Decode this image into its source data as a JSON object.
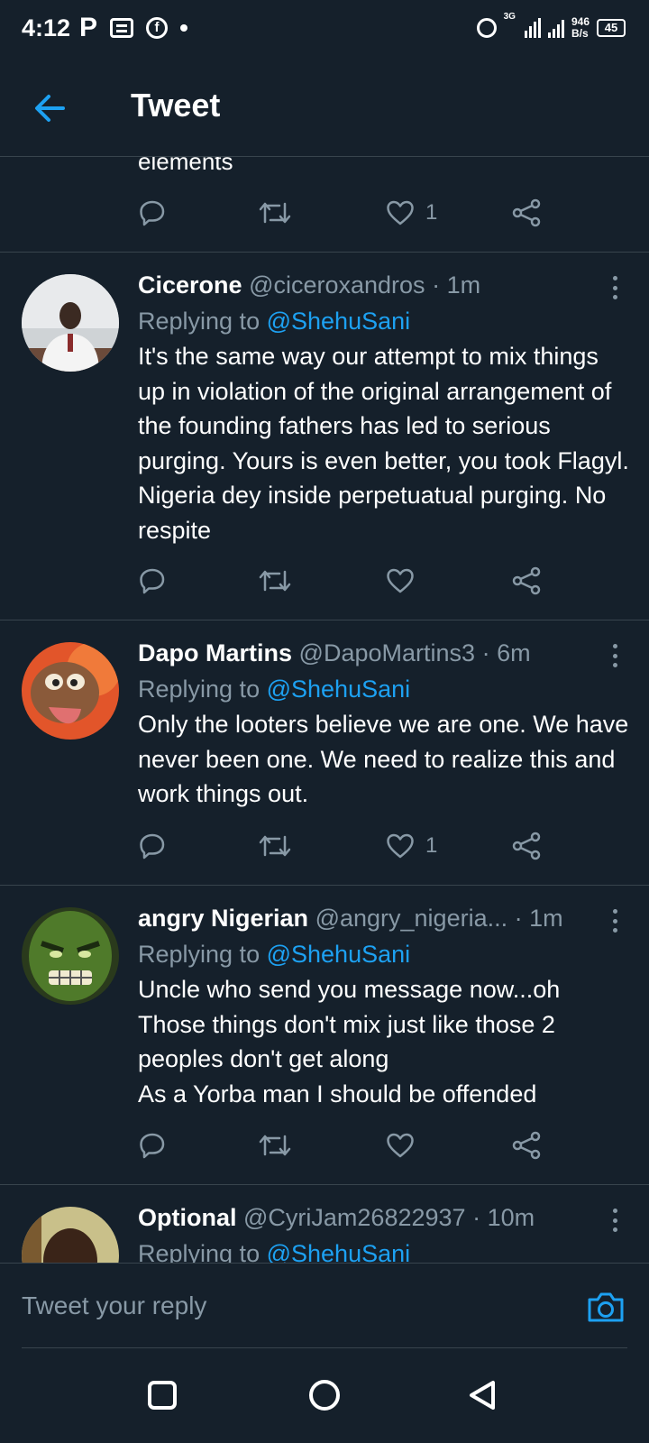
{
  "status_bar": {
    "time": "4:12",
    "left_icons": [
      "parking-icon",
      "message-icon",
      "facebook-icon",
      "dot-icon"
    ],
    "network_type": "3G",
    "speed_value": "946",
    "speed_unit": "B/s",
    "battery": "45"
  },
  "header": {
    "title": "Tweet"
  },
  "partial_tweet": {
    "text": "elements",
    "like_count": "1"
  },
  "replies": [
    {
      "name": "Cicerone",
      "handle": "@ciceroxandros",
      "separator": "·",
      "time": "1m",
      "replying_prefix": "Replying to",
      "replying_to": "@ShehuSani",
      "body": "It's the same way our attempt to mix things up in violation of the original arrangement of the founding fathers has led to serious purging. Yours is even better, you took Flagyl. Nigeria dey inside perpetuatual purging. No respite",
      "like_count": ""
    },
    {
      "name": "Dapo Martins",
      "handle": "@DapoMartins3",
      "separator": "·",
      "time": "6m",
      "replying_prefix": "Replying to",
      "replying_to": "@ShehuSani",
      "body": "Only the looters believe we are one. We have never been one. We need to realize this and work things out.",
      "like_count": "1"
    },
    {
      "name": "angry Nigerian",
      "handle": "@angry_nigeria...",
      "separator": "·",
      "time": "1m",
      "replying_prefix": "Replying to",
      "replying_to": "@ShehuSani",
      "body": "Uncle who send you message now...oh\nThose things don't mix just like those 2 peoples don't  get along\nAs a Yorba man I should be offended",
      "like_count": ""
    },
    {
      "name": "Optional",
      "handle": "@CyriJam26822937",
      "separator": "·",
      "time": "10m",
      "replying_prefix": "Replying to",
      "replying_to": "@ShehuSani",
      "body": "",
      "like_count": ""
    }
  ],
  "composer": {
    "placeholder": "Tweet your reply"
  },
  "colors": {
    "background": "#15202b",
    "divider": "#38444d",
    "secondary_text": "#8899a6",
    "accent": "#1da1f2"
  }
}
